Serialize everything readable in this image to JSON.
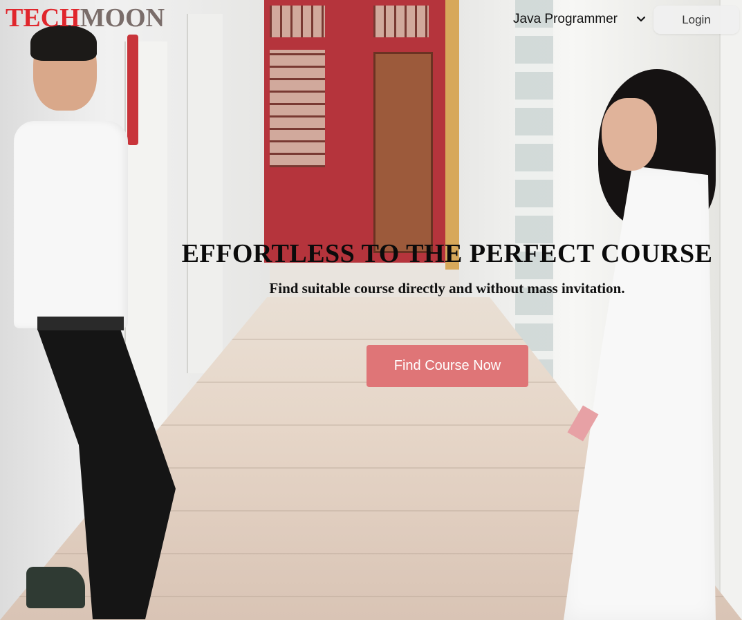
{
  "brand": {
    "part1": "TECH",
    "part2": "MOON",
    "colors": {
      "part1": "#e0262c",
      "part2": "#7a6d6a"
    }
  },
  "nav": {
    "course_select": {
      "value": "Java Programmer",
      "icon": "chevron-down-icon"
    },
    "login_label": "Login"
  },
  "hero": {
    "title": "EFFORTLESS TO THE PERFECT COURSE",
    "subtitle": "Find suitable course directly and without mass invitation.",
    "cta_label": "Find Course Now",
    "cta_color": "#df7577"
  }
}
